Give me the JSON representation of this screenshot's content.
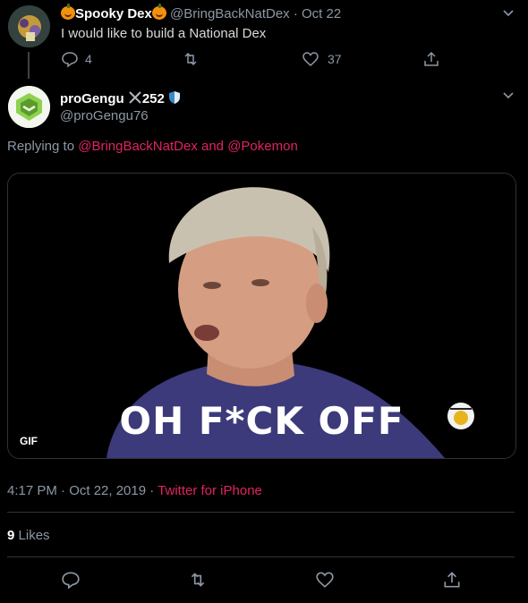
{
  "parent": {
    "display_name": "Spooky Dex",
    "handle": "@BringBackNatDex",
    "date": "Oct 22",
    "text": "I would like to build a National Dex",
    "reply_count": "4",
    "like_count": "37"
  },
  "reply": {
    "display_name": "proGengu",
    "name_suffix": "252",
    "handle": "@proGengu76",
    "replying_prefix": "Replying to",
    "replying_handle_1": "@BringBackNatDex",
    "replying_and": "and",
    "replying_handle_2": "@Pokemon",
    "media_caption": "OH F*CK OFF",
    "gif_badge": "GIF",
    "timestamp": "4:17 PM · Oct 22, 2019",
    "separator": "·",
    "source": "Twitter for iPhone",
    "likes_count": "9",
    "likes_label": "Likes"
  },
  "icons": {
    "reply": "reply-icon",
    "retweet": "retweet-icon",
    "like": "heart-icon",
    "share": "share-icon",
    "menu": "chevron-down-icon"
  },
  "colors": {
    "background": "#000000",
    "accent_link": "#e0245e",
    "muted_text": "#8b98a5"
  }
}
